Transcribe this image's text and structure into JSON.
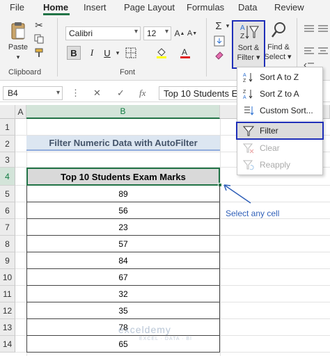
{
  "menu_tabs": [
    "File",
    "Home",
    "Insert",
    "Page Layout",
    "Formulas",
    "Data",
    "Review"
  ],
  "clipboard": {
    "paste_label": "Paste",
    "group_label": "Clipboard"
  },
  "font": {
    "name": "Calibri",
    "size": "12",
    "group_label": "Font",
    "bold": "B",
    "italic": "I",
    "underline": "U"
  },
  "sort_filter": {
    "label_line1": "Sort &",
    "label_line2": "Filter",
    "icon_letters": "A Z"
  },
  "find_select": {
    "label_line1": "Find &",
    "label_line2": "Select"
  },
  "formula_bar": {
    "name_box": "B4",
    "fx": "fx",
    "content": "Top 10 Students Ex"
  },
  "columns": [
    "A",
    "B"
  ],
  "rows": [
    "1",
    "2",
    "3",
    "4",
    "5",
    "6",
    "7",
    "8",
    "9",
    "10",
    "11",
    "12",
    "13",
    "14"
  ],
  "sheet": {
    "title": "Filter Numeric Data with AutoFilter",
    "table_header": "Top 10 Students Exam Marks",
    "marks": [
      "89",
      "56",
      "23",
      "57",
      "84",
      "67",
      "32",
      "35",
      "78",
      "65"
    ]
  },
  "dropdown_menu": {
    "items": [
      {
        "label": "Sort A to Z",
        "icon": "sort-az-icon",
        "enabled": true
      },
      {
        "label": "Sort Z to A",
        "icon": "sort-za-icon",
        "enabled": true
      },
      {
        "label": "Custom Sort...",
        "icon": "custom-sort-icon",
        "enabled": true
      },
      {
        "label": "Filter",
        "icon": "funnel-icon",
        "enabled": true
      },
      {
        "label": "Clear",
        "icon": "clear-filter-icon",
        "enabled": false
      },
      {
        "label": "Reapply",
        "icon": "reapply-icon",
        "enabled": false
      }
    ]
  },
  "annotation": "Select any cell",
  "watermark": {
    "brand": "exceldemy",
    "tagline": "EXCEL · DATA · BI"
  },
  "colors": {
    "accent": "#217346",
    "highlight_border": "#1f2fb8",
    "title_fill": "#dce6f1",
    "annotation": "#2f5fb8"
  }
}
